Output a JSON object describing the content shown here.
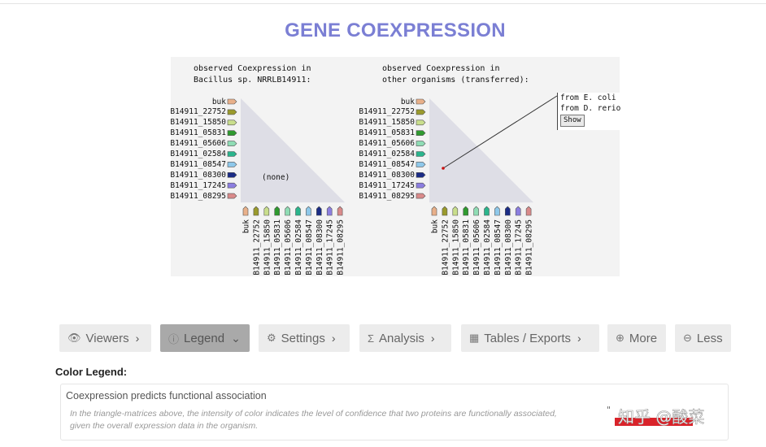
{
  "page": {
    "title": "GENE COEXPRESSION"
  },
  "left_panel": {
    "header_line1": "observed Coexpression in",
    "header_line2": "Bacillus sp. NRRLB14911:",
    "center_text": "(none)"
  },
  "right_panel": {
    "header_line1": "observed Coexpression in",
    "header_line2": "other organisms (transferred):",
    "popup": {
      "line1": "from E. coli",
      "line2": "from D. rerio",
      "button": "Show"
    }
  },
  "genes": [
    {
      "name": "buk",
      "color": "#e8b08a"
    },
    {
      "name": "B14911_22752",
      "color": "#9a9a2c"
    },
    {
      "name": "B14911_15850",
      "color": "#c9de8c"
    },
    {
      "name": "B14911_05831",
      "color": "#2f9a2f"
    },
    {
      "name": "B14911_05606",
      "color": "#8fdcb4"
    },
    {
      "name": "B14911_02584",
      "color": "#2bb58c"
    },
    {
      "name": "B14911_08547",
      "color": "#8ec8ea"
    },
    {
      "name": "B14911_08300",
      "color": "#1b2c86"
    },
    {
      "name": "B14911_17245",
      "color": "#8c7ee0"
    },
    {
      "name": "B14911_08295",
      "color": "#d98a8a"
    }
  ],
  "toolbar": {
    "buttons": [
      {
        "label": "Viewers",
        "icon": "eye-icon",
        "glyph": "👁",
        "suffix": "›"
      },
      {
        "label": "Legend",
        "icon": "info-icon",
        "glyph": "ⓘ",
        "suffix": "⌄"
      },
      {
        "label": "Settings",
        "icon": "gear-icon",
        "glyph": "⚙",
        "suffix": "›"
      },
      {
        "label": "Analysis",
        "icon": "sigma-icon",
        "glyph": "Σ",
        "suffix": "›"
      },
      {
        "label": "Tables / Exports",
        "icon": "table-icon",
        "glyph": "▦",
        "suffix": "›"
      },
      {
        "label": "More",
        "icon": "plus-circle-icon",
        "glyph": "⊕",
        "suffix": ""
      },
      {
        "label": "Less",
        "icon": "minus-circle-icon",
        "glyph": "⊖",
        "suffix": ""
      }
    ]
  },
  "legend": {
    "title": "Color Legend:",
    "heading": "Coexpression predicts functional association",
    "description": "In the triangle-matrices above, the intensity of color indicates the level of confidence that two proteins are functionally associated, given the overall expression data in the organism."
  },
  "watermark": {
    "text": "知乎 @酸菜"
  },
  "colors": {
    "title": "#7b7fd4",
    "toolbar_bg": "#ececec",
    "toolbar_active": "#a9a9a9",
    "viz_bg": "#f3f3f3",
    "triangle": "#dedee6"
  }
}
